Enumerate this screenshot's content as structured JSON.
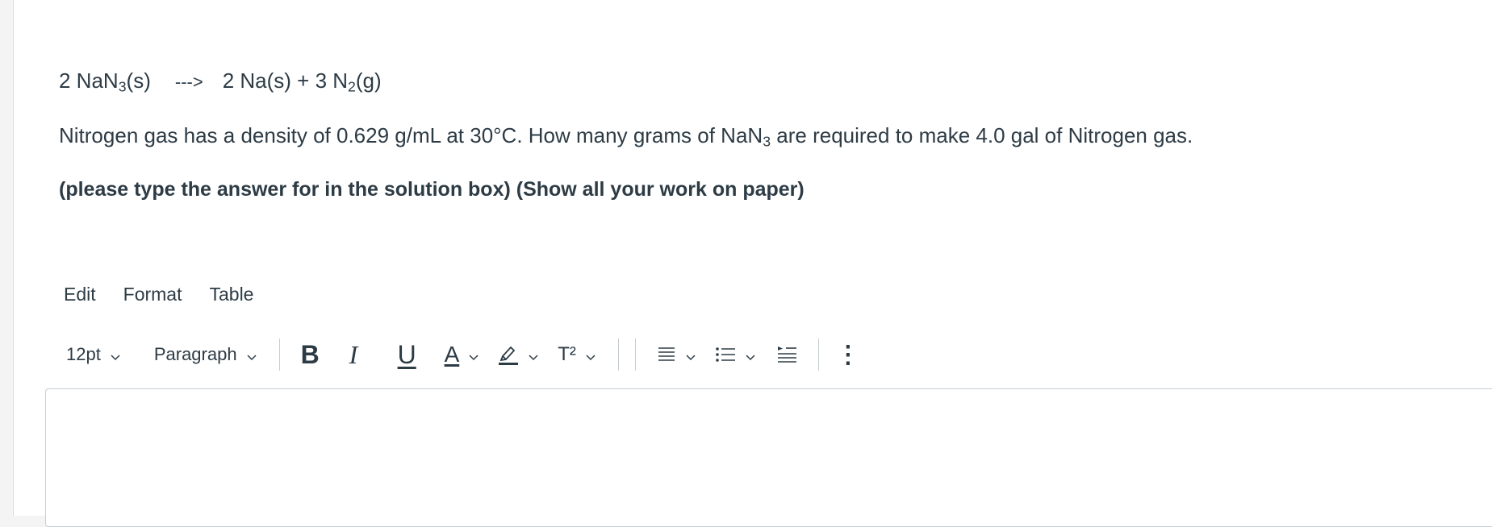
{
  "question": {
    "equation": {
      "left_coef": "2 NaN",
      "left_sub": "3",
      "left_state": "(s)",
      "arrow": "--->",
      "right_a": "2 Na(s) + 3 N",
      "right_sub": "2",
      "right_state": "(g)"
    },
    "text_before": "Nitrogen gas has a density of 0.629 g/mL at 30°C. How many grams of NaN",
    "text_sub": "3",
    "text_after": " are required to make 4.0 gal of Nitrogen gas.",
    "instruction": "(please type the answer for in the solution box) (Show all your work on paper)"
  },
  "menubar": {
    "edit": "Edit",
    "format": "Format",
    "table": "Table"
  },
  "toolbar": {
    "font_size": "12pt",
    "block_format": "Paragraph",
    "bold": "B",
    "italic": "I",
    "underline": "U",
    "text_color": "A",
    "superscript": "T²",
    "more": "⋮",
    "icons": {
      "font_size_chevron": "chevron-down-icon",
      "highlight": "highlighter-icon",
      "align": "align-icon",
      "list": "bullet-list-icon",
      "indent": "indent-icon"
    }
  },
  "editor": {
    "value": ""
  }
}
